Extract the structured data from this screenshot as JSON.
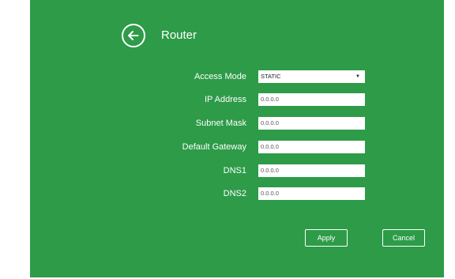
{
  "page": {
    "title": "Router"
  },
  "form": {
    "access_mode": {
      "label": "Access Mode",
      "value": "STATIC"
    },
    "ip_address": {
      "label": "IP Address",
      "value": "0.0.0.0"
    },
    "subnet_mask": {
      "label": "Subnet Mask",
      "value": "0.0.0.0"
    },
    "default_gateway": {
      "label": "Default Gateway",
      "value": "0.0.0.0"
    },
    "dns1": {
      "label": "DNS1",
      "value": "0.0.0.0"
    },
    "dns2": {
      "label": "DNS2",
      "value": "0.0.0.0"
    }
  },
  "actions": {
    "apply_label": "Apply",
    "cancel_label": "Cancel"
  },
  "icons": {
    "back": "back-arrow-circle-icon",
    "dropdown": "dropdown-caret-icon"
  },
  "colors": {
    "panel_bg": "#2d9b48",
    "text": "#ffffff",
    "field_bg": "#ffffff"
  }
}
